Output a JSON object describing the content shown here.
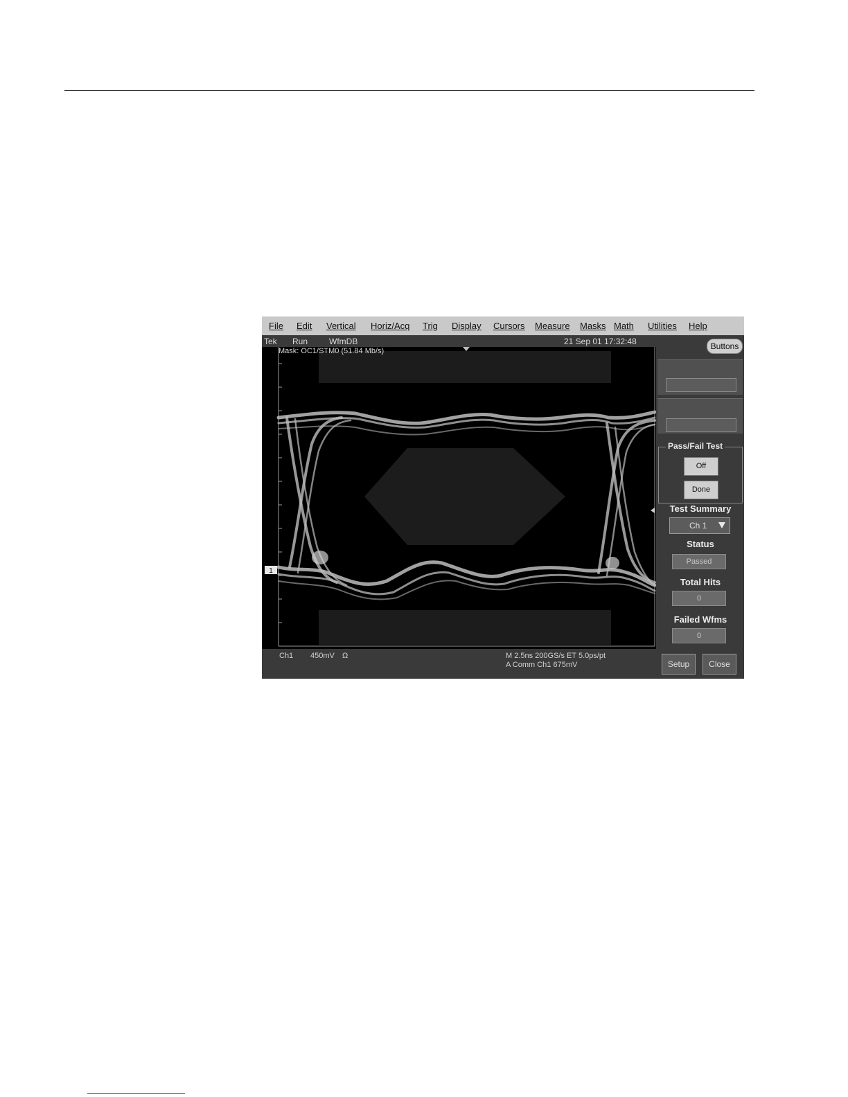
{
  "menu": {
    "items": [
      {
        "label": "File",
        "name": "menu-file"
      },
      {
        "label": "Edit",
        "name": "menu-edit"
      },
      {
        "label": "Vertical",
        "name": "menu-vertical"
      },
      {
        "label": "Horiz/Acq",
        "name": "menu-horiz-acq"
      },
      {
        "label": "Trig",
        "name": "menu-trig"
      },
      {
        "label": "Display",
        "name": "menu-display"
      },
      {
        "label": "Cursors",
        "name": "menu-cursors"
      },
      {
        "label": "Measure",
        "name": "menu-measure"
      },
      {
        "label": "Masks",
        "name": "menu-masks"
      },
      {
        "label": "Math",
        "name": "menu-math"
      },
      {
        "label": "Utilities",
        "name": "menu-utilities"
      },
      {
        "label": "Help",
        "name": "menu-help"
      }
    ]
  },
  "status": {
    "brand": "Tek",
    "run_state": "Run",
    "mode": "WfmDB",
    "datetime": "21 Sep 01 17:32:48",
    "buttons_label": "Buttons"
  },
  "display": {
    "mask_label": "Mask: OC1/STM0 (51.84 Mb/s)",
    "channel_marker": "1"
  },
  "readouts": {
    "channel": "Ch1",
    "scale": "450mV",
    "impedance": "Ω",
    "horizontal": "M 2.5ns 200GS/s ET 5.0ps/pt",
    "trigger_line": "A Comm     Ch1     675mV"
  },
  "panel": {
    "pass_fail_title": "Pass/Fail Test",
    "off_label": "Off",
    "done_label": "Done",
    "test_summary_label": "Test Summary",
    "channel_select": "Ch 1",
    "status_label": "Status",
    "status_value": "Passed",
    "total_hits_label": "Total Hits",
    "total_hits_value": "0",
    "failed_wfms_label": "Failed Wfms",
    "failed_wfms_value": "0",
    "setup_label": "Setup",
    "close_label": "Close"
  },
  "colors": {
    "menubar": "#c9c9c9",
    "panel": "#3a3a3a",
    "screen": "#000000",
    "mask": "#1c1c1c",
    "trace": "#bdbdbd"
  }
}
